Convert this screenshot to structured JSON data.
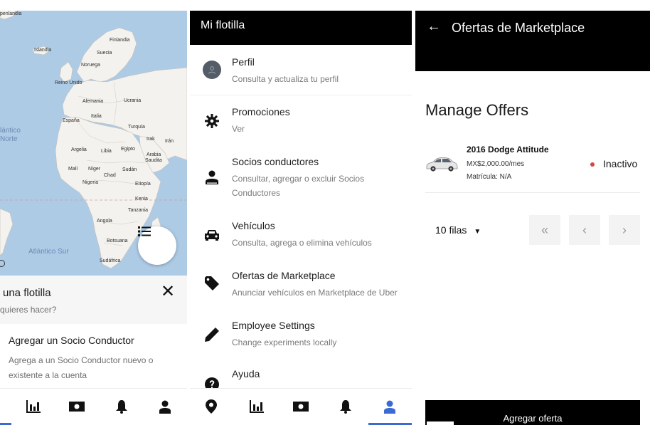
{
  "map_panel": {
    "labels": {
      "top_edge": "penlandia",
      "finlandia": "Finlandia",
      "islandia": "Islandia",
      "suecia": "Suecia",
      "noruega": "Noruega",
      "reino_unido": "Reino Unido",
      "alemania": "Alemania",
      "ucrania": "Ucrania",
      "espana": "España",
      "italia": "Italia",
      "turquia": "Turquía",
      "irak": "Irak",
      "iran": "Irán",
      "atlantico_norte_1": "lántico",
      "atlantico_norte_2": "Norte",
      "argelia": "Argelia",
      "libia": "Libia",
      "egipto": "Egipto",
      "arabia": "Arabia",
      "saudita": "Saudita",
      "mali": "Malí",
      "niger": "Níger",
      "chad": "Chad",
      "sudan": "Sudán",
      "nigeria": "Nigeria",
      "etiopia": "Etiopía",
      "kenia": "Kenia",
      "tanzania": "Tanzania",
      "angola": "Angola",
      "botsuana": "Botsuana",
      "sudafrica": "Sudáfrica",
      "atlantico_sur": "Atlántico Sur"
    },
    "sheet": {
      "title": "una flotilla",
      "subtitle": "quieres hacer?",
      "option_title": "Agregar un Socio Conductor",
      "option_desc": "Agrega a un Socio Conductor nuevo o existente a la cuenta"
    },
    "icons": [
      "list-icon",
      "close-icon",
      "chart-icon",
      "money-icon",
      "bell-icon",
      "person-icon"
    ]
  },
  "menu_panel": {
    "header": "Mi flotilla",
    "items": [
      {
        "title": "Perfil",
        "desc": "Consulta y actualiza tu perfil",
        "icon": "avatar-icon"
      },
      {
        "title": "Promociones",
        "desc": "Ver",
        "icon": "gear-icon"
      },
      {
        "title": "Socios conductores",
        "desc": "Consultar, agregar o excluir Socios Conductores",
        "icon": "driver-icon"
      },
      {
        "title": "Vehículos",
        "desc": "Consulta, agrega o elimina vehículos",
        "icon": "car-icon"
      },
      {
        "title": "Ofertas de Marketplace",
        "desc": "Anunciar vehículos en Marketplace de Uber",
        "icon": "tag-icon"
      },
      {
        "title": "Employee Settings",
        "desc": "Change experiments locally",
        "icon": "pencil-icon"
      },
      {
        "title": "Ayuda",
        "desc": "",
        "icon": "help-icon"
      }
    ],
    "tabs": [
      "location-icon",
      "chart-icon",
      "money-icon",
      "bell-icon",
      "person-icon"
    ],
    "active_tab_color": "#3a6ad4"
  },
  "offers_panel": {
    "header": "Ofertas de Marketplace",
    "back_glyph": "←",
    "heading": "Manage Offers",
    "vehicle": {
      "name": "2016 Dodge Attitude",
      "price": "MX$2,000.00/mes",
      "plate": "Matrícula: N/A",
      "status": "Inactivo",
      "status_color": "#d64545"
    },
    "pagination": {
      "rows_label": "10 filas",
      "chevron": "⌄",
      "first": "«",
      "prev": "‹",
      "next": "›"
    },
    "add_button": "Agregar oferta"
  }
}
